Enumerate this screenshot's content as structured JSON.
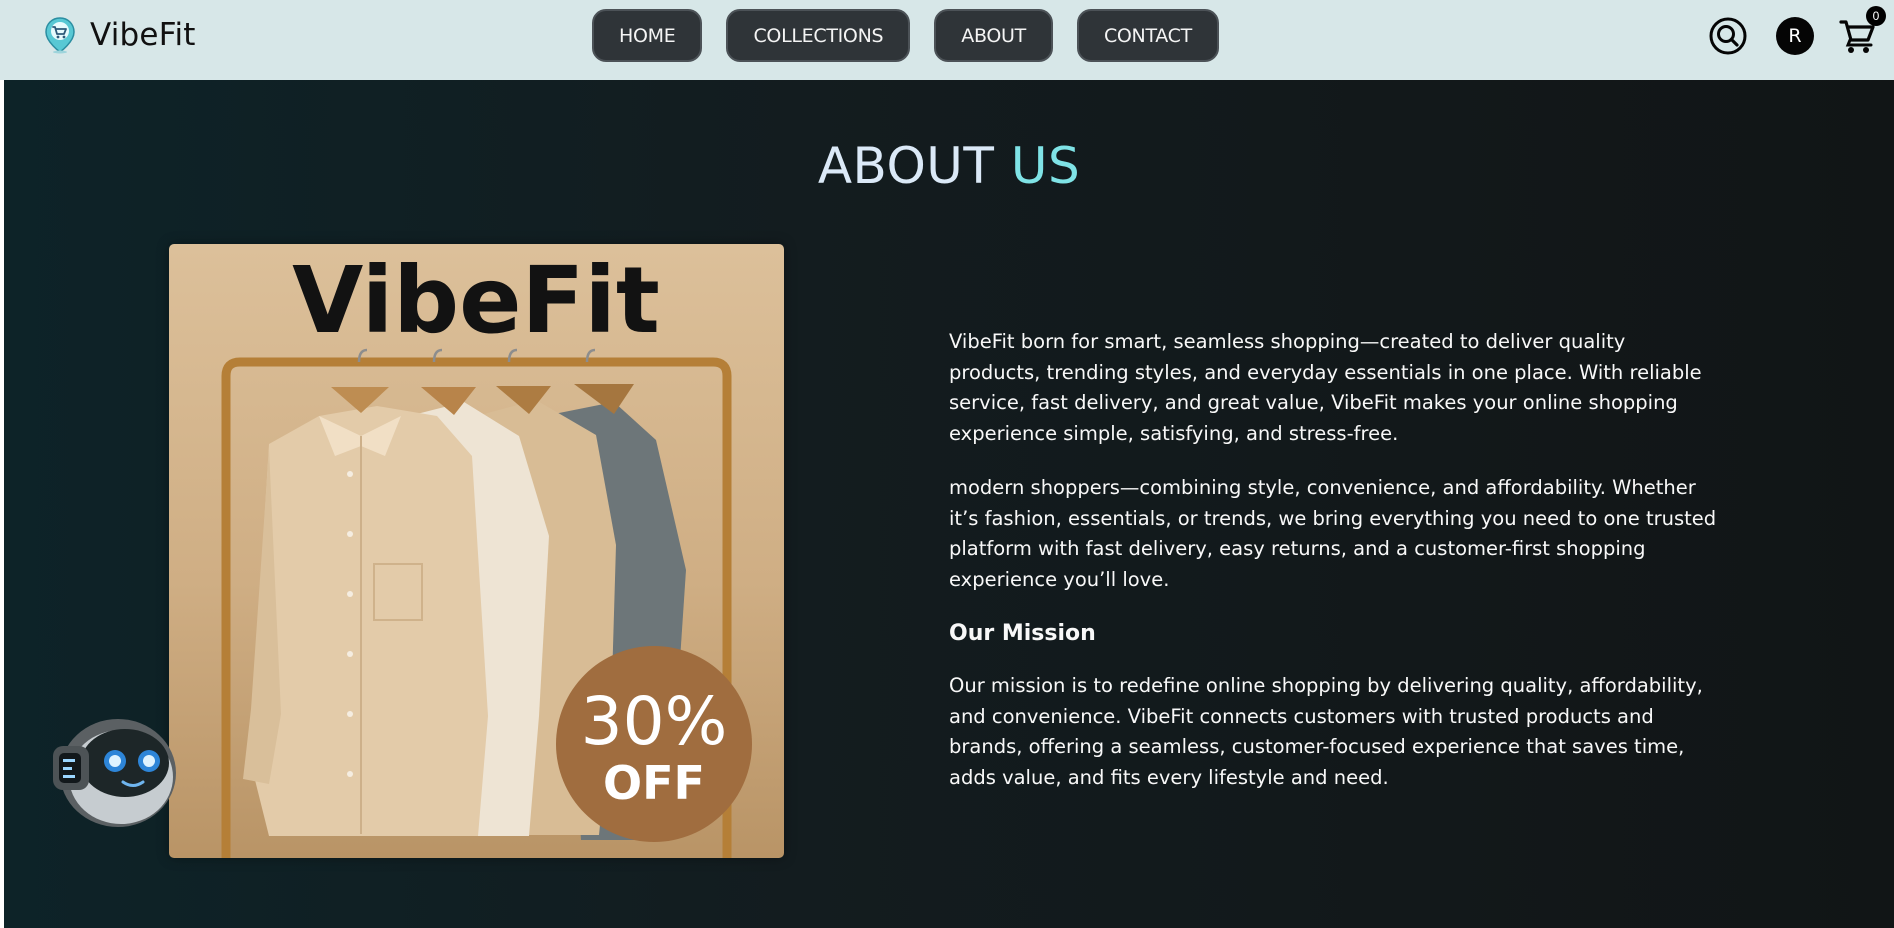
{
  "brand": {
    "name": "VibeFit",
    "logo_icon": "map-pin-cart-icon"
  },
  "nav": {
    "items": [
      {
        "label": "HOME"
      },
      {
        "label": "COLLECTIONS"
      },
      {
        "label": "ABOUT"
      },
      {
        "label": "CONTACT"
      }
    ]
  },
  "header_actions": {
    "search_icon": "search-icon",
    "avatar_initial": "R",
    "cart_icon": "cart-icon",
    "cart_count": "0"
  },
  "about": {
    "title_part1": "ABOUT",
    "title_part2": "US",
    "hero_image": {
      "brand_text": "VibeFit",
      "badge_value": "30%",
      "badge_label": "OFF"
    },
    "paragraph1": "VibeFit born for smart, seamless shopping—created to deliver quality products, trending styles, and everyday essentials in one place. With reliable service, fast delivery, and great value, VibeFit makes your online shopping experience simple, satisfying, and stress-free.",
    "paragraph2": "modern shoppers—combining style, convenience, and affordability. Whether it’s fashion, essentials, or trends, we bring everything you need to one trusted platform with fast delivery, easy returns, and a customer-first shopping experience you’ll love.",
    "mission_heading": "Our Mission",
    "mission_text": "Our mission is to redefine online shopping by delivering quality, affordability, and convenience. VibeFit connects customers with trusted products and brands, offering a seamless, customer-focused experience that saves time, adds value, and fits every lifestyle and need."
  },
  "colors": {
    "navbar_bg": "#d7e7e8",
    "nav_button_bg": "#2f3438",
    "main_bg": "#111a1d",
    "title_color": "#dbe9f7",
    "title_accent": "#7fe3e6"
  },
  "chatbot": {
    "icon": "robot-chat-icon"
  }
}
